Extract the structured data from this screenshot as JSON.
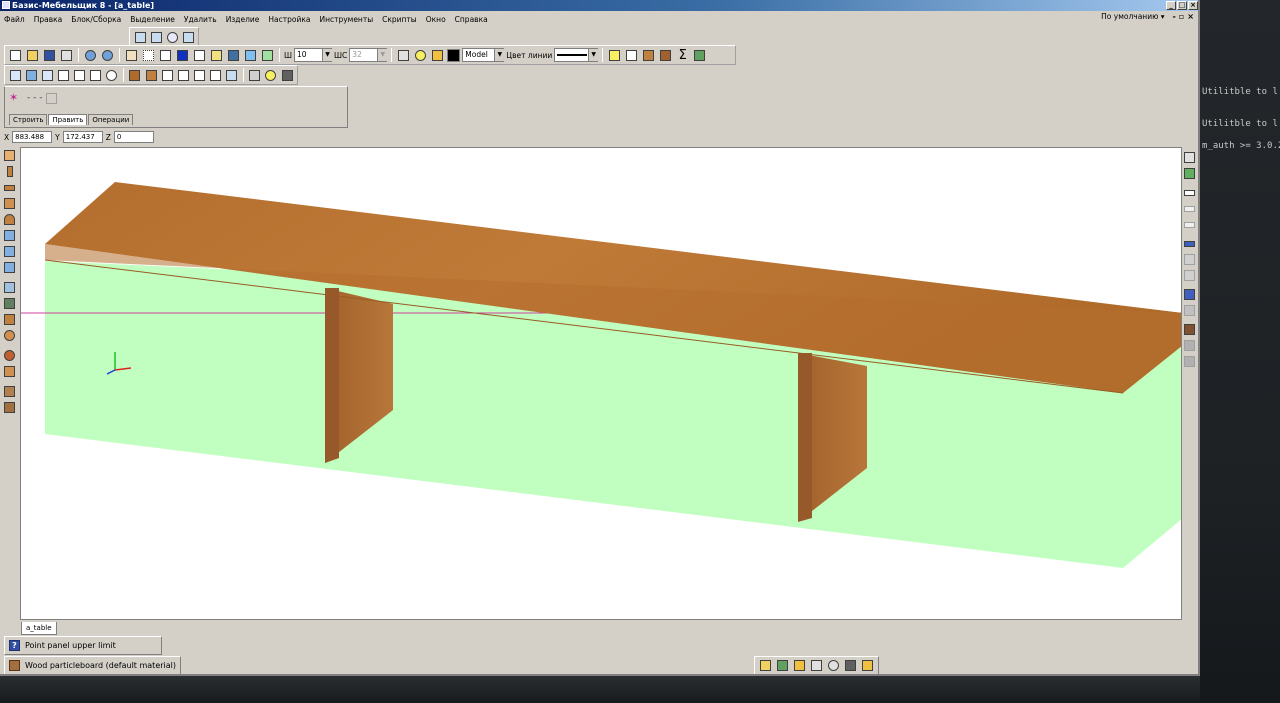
{
  "window": {
    "title": "Базис-Мебельщик 8 - [a_table]"
  },
  "menu": {
    "items": [
      "Файл",
      "Правка",
      "Блок/Сборка",
      "Выделение",
      "Удалить",
      "Изделие",
      "Настройка",
      "Инструменты",
      "Скрипты",
      "Окно",
      "Справка"
    ],
    "preset": "По умолчанию"
  },
  "toolbar": {
    "sh_label": "Ш",
    "sh_value": "10",
    "shs_label": "ШС",
    "shs_value": "32",
    "layer_value": "Model",
    "line_color_label": "Цвет линии"
  },
  "command_panel": {
    "tabs": [
      "Строить",
      "Править",
      "Операции"
    ],
    "active_tab": "Править"
  },
  "coords": {
    "x_label": "X",
    "x_value": "883.488",
    "y_label": "Y",
    "y_value": "172.437",
    "z_label": "Z",
    "z_value": "0"
  },
  "document_tab": "a_table",
  "status": {
    "hint": "Point panel upper limit",
    "material": "Wood particleboard (default material)"
  },
  "terminal": {
    "lines": [
      "Utilitble to l",
      "Utilitble to l",
      "m_auth >= 3.0.2"
    ]
  },
  "colors": {
    "wood": "#b06a2a",
    "floor": "#c0ffc0",
    "axis_line": "#d040a0"
  },
  "icons": {
    "left_toolbar": [
      "panel-icon",
      "vertical-panel-icon",
      "horizontal-panel-icon",
      "box-icon",
      "curved-panel-icon",
      "shelf-icon",
      "divider-icon",
      "rail-icon",
      "facade-icon",
      "door-icon",
      "profile-icon",
      "rotate-body-icon",
      "sphere-icon",
      "cone-icon",
      "fitting-icon",
      "cabinet-icon"
    ],
    "right_toolbar": [
      "view-icon",
      "material-icon",
      "dimension-icon",
      "dimension-x-icon",
      "dimension-y-icon",
      "layer-icon",
      "edge-icon",
      "edge-alt-icon",
      "cube-icon",
      "cube-alt-icon",
      "cabinet-icon",
      "cabinet-alt-icon",
      "cabinet-gray-icon"
    ],
    "bottom_toolbar": [
      "tree-icon",
      "edit-icon",
      "grid-icon",
      "zoom-window-icon",
      "zoom-icon",
      "copy-icon",
      "layers-icon"
    ]
  }
}
